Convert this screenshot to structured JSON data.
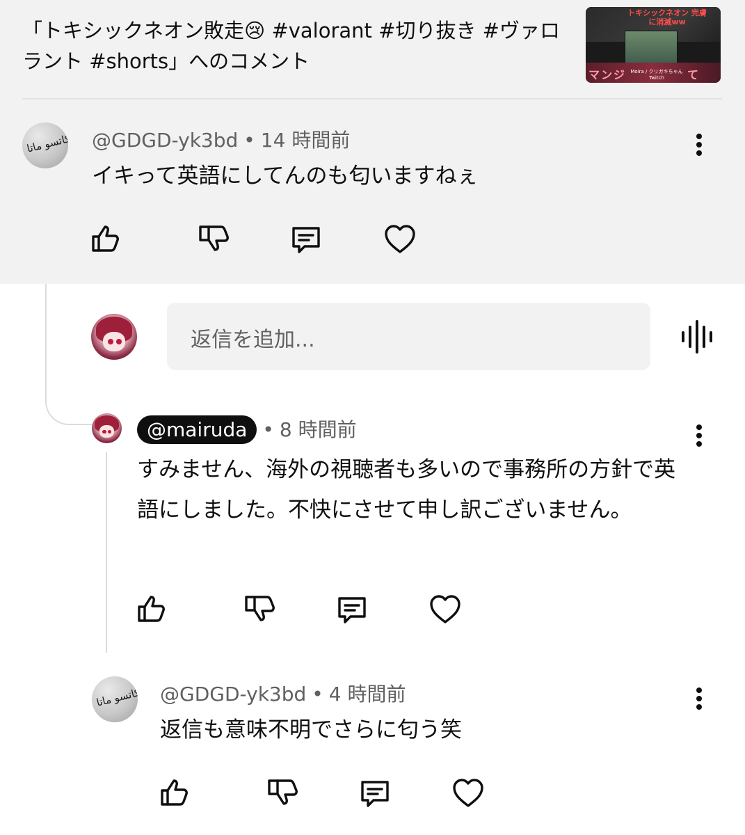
{
  "header": {
    "video_title": "「トキシックネオン敗走😢 #valorant #切り抜き #ヴァロラント #shorts」へのコメント",
    "thumbnail": {
      "red_text": "トキシックネオン 完膚に消滅ww",
      "pink_text": "マンジ",
      "pink_text_end": "て(?)",
      "caption": "Moira / クリガキちゃん Twitch"
    }
  },
  "comments": [
    {
      "handle": "@GDGD-yk3bd",
      "separator": "•",
      "time": "14 時間前",
      "text": "イキって英語にしてんのも匂いますねぇ",
      "avatar": "arabic-script-avatar",
      "avatar_text": "ﺍﻟﻮﺯ ﻛﺎﺗﺴﻮ ﻣﺎﺗﺎ"
    },
    {
      "handle": "@mairuda",
      "separator": "•",
      "time": "8 時間前",
      "text": "すみません、海外の視聴者も多いので事務所の方針で英語にしました。不快にさせて申し訳ございません。",
      "avatar": "anime-avatar",
      "is_creator": true
    },
    {
      "handle": "@GDGD-yk3bd",
      "separator": "•",
      "time": "4 時間前",
      "text": "返信も意味不明でさらに匂う笑",
      "avatar": "arabic-script-avatar",
      "avatar_text": "ﺍﻟﻮﺯ ﻛﺎﺗﺴﻮ ﻣﺎﺗﺎ"
    }
  ],
  "reply_input": {
    "placeholder": "返信を追加..."
  },
  "icons": {
    "like": "thumbs-up-icon",
    "dislike": "thumbs-down-icon",
    "reply": "comment-icon",
    "heart": "heart-icon",
    "more": "more-vert-icon",
    "voice": "voice-search-icon"
  },
  "colors": {
    "highlight_bg": "#f2f2f2",
    "text_primary": "#0f0f0f",
    "text_secondary": "#606060",
    "creator_chip_bg": "#0f0f0f"
  }
}
